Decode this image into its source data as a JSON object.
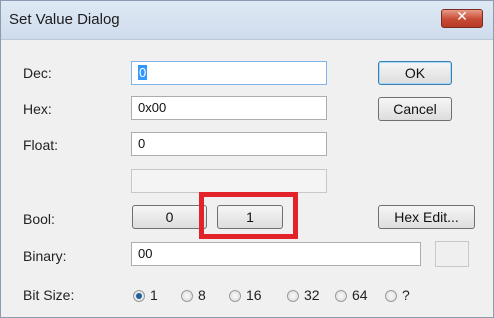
{
  "window": {
    "title": "Set Value Dialog",
    "close_icon": "close-icon"
  },
  "fields": {
    "dec": {
      "label": "Dec:",
      "value": "0"
    },
    "hex": {
      "label": "Hex:",
      "value": "0x00"
    },
    "float": {
      "label": "Float:",
      "value": "0"
    },
    "extra": {
      "value": ""
    },
    "binary": {
      "label": "Binary:",
      "value": "00"
    }
  },
  "buttons": {
    "ok": "OK",
    "cancel": "Cancel",
    "hex_edit": "Hex Edit..."
  },
  "bool": {
    "label": "Bool:",
    "false_label": "0",
    "true_label": "1"
  },
  "bit_size": {
    "label": "Bit Size:",
    "options": [
      "1",
      "8",
      "16",
      "32",
      "64",
      "?"
    ],
    "selected": "1"
  },
  "colors": {
    "highlight": "#e2242a",
    "selection": "#3399ff"
  }
}
